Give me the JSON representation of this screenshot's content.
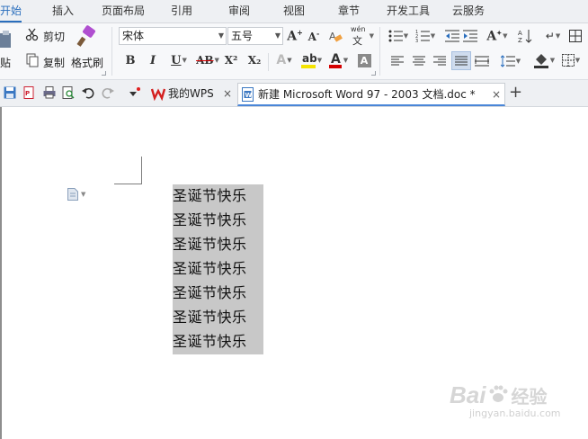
{
  "menu": {
    "tabs": [
      "开始",
      "插入",
      "页面布局",
      "引用",
      "审阅",
      "视图",
      "章节",
      "开发工具",
      "云服务"
    ],
    "active_index": 0
  },
  "ribbon": {
    "paste_label": "贴",
    "cut_label": "剪切",
    "copy_label": "复制",
    "format_painter_label": "格式刷",
    "font_name": "宋体",
    "font_size": "五号",
    "bold": "B",
    "italic": "I",
    "underline": "U",
    "strikethrough": "AB",
    "superscript": "X²",
    "subscript": "X₂",
    "font_color_letter": "A",
    "pinyin_glyph": "文",
    "pinyin_small": "wén",
    "accent_color": "#2a6ebd",
    "highlight_color": "#f5e400",
    "font_color": "#d40000"
  },
  "tabbar": {
    "wps_tab_label": "我的WPS",
    "doc_tab_label": "新建 Microsoft Word 97 - 2003 文档.doc *",
    "close_glyph": "×",
    "new_tab_glyph": "+"
  },
  "document": {
    "lines": [
      "圣诞节快乐",
      "圣诞节快乐",
      "圣诞节快乐",
      "圣诞节快乐",
      "圣诞节快乐",
      "圣诞节快乐",
      "圣诞节快乐"
    ],
    "selection_color": "#c8c8c8"
  },
  "watermark": {
    "brand": "Bai",
    "brand2": "经验",
    "url": "jingyan.baidu.com"
  }
}
